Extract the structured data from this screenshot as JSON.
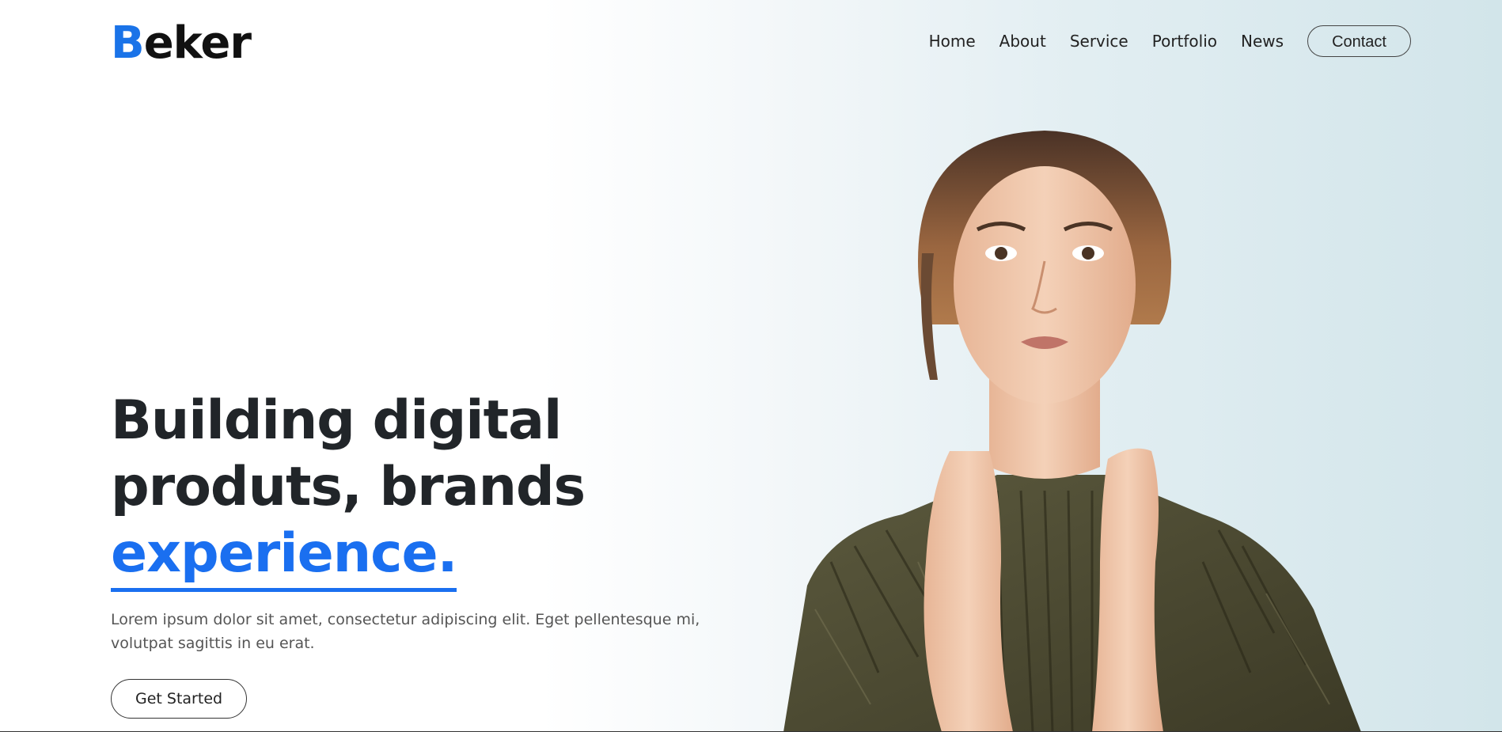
{
  "header": {
    "logo_first": "B",
    "logo_rest": "eker",
    "nav": [
      "Home",
      "About",
      "Service",
      "Portfolio",
      "News"
    ],
    "contact_label": "Contact"
  },
  "hero": {
    "title_line1": "Building digital",
    "title_line2": "produts, brands",
    "title_accent": "experience.",
    "description": "Lorem ipsum dolor sit amet, consectetur adipiscing elit. Eget pellentesque mi, volutpat sagittis in eu erat.",
    "cta_label": "Get Started"
  },
  "colors": {
    "accent": "#1a6ff0",
    "text_dark": "#212529",
    "garment": "#4f4c33",
    "skin": "#eec2a3",
    "hair": "#8a5a3a"
  }
}
